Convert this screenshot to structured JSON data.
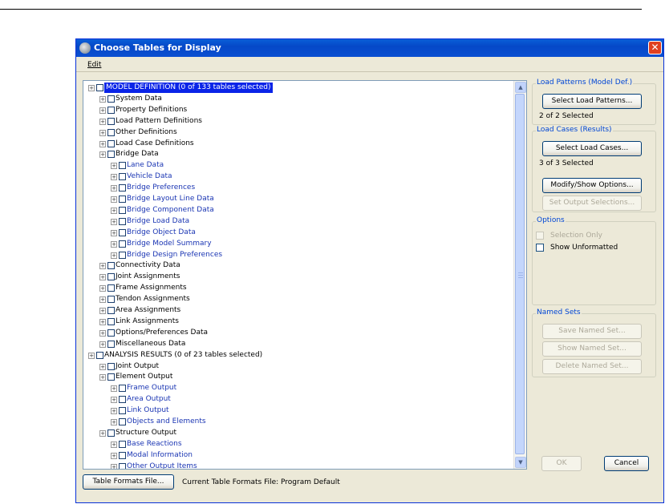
{
  "window": {
    "title": "Choose Tables for Display",
    "close_glyph": "✕",
    "icon": "app-globe-icon"
  },
  "menu": {
    "edit": "Edit"
  },
  "tree": {
    "rows": [
      {
        "label": "MODEL DEFINITION  (0 of 133 tables selected)",
        "level": 0,
        "color": "black",
        "selected": true
      },
      {
        "label": "System Data",
        "level": 1,
        "color": "black"
      },
      {
        "label": "Property Definitions",
        "level": 1,
        "color": "black"
      },
      {
        "label": "Load Pattern Definitions",
        "level": 1,
        "color": "black"
      },
      {
        "label": "Other Definitions",
        "level": 1,
        "color": "black"
      },
      {
        "label": "Load Case Definitions",
        "level": 1,
        "color": "black"
      },
      {
        "label": "Bridge Data",
        "level": 1,
        "color": "black"
      },
      {
        "label": "Lane Data",
        "level": 2,
        "color": "blue"
      },
      {
        "label": "Vehicle Data",
        "level": 2,
        "color": "blue"
      },
      {
        "label": "Bridge Preferences",
        "level": 2,
        "color": "blue"
      },
      {
        "label": "Bridge Layout Line Data",
        "level": 2,
        "color": "blue"
      },
      {
        "label": "Bridge Component Data",
        "level": 2,
        "color": "blue"
      },
      {
        "label": "Bridge Load Data",
        "level": 2,
        "color": "blue"
      },
      {
        "label": "Bridge Object Data",
        "level": 2,
        "color": "blue"
      },
      {
        "label": "Bridge Model Summary",
        "level": 2,
        "color": "blue"
      },
      {
        "label": "Bridge Design Preferences",
        "level": 2,
        "color": "blue"
      },
      {
        "label": "Connectivity Data",
        "level": 1,
        "color": "black"
      },
      {
        "label": "Joint Assignments",
        "level": 1,
        "color": "black"
      },
      {
        "label": "Frame Assignments",
        "level": 1,
        "color": "black"
      },
      {
        "label": "Tendon Assignments",
        "level": 1,
        "color": "black"
      },
      {
        "label": "Area Assignments",
        "level": 1,
        "color": "black"
      },
      {
        "label": "Link Assignments",
        "level": 1,
        "color": "black"
      },
      {
        "label": "Options/Preferences Data",
        "level": 1,
        "color": "black"
      },
      {
        "label": "Miscellaneous Data",
        "level": 1,
        "color": "black"
      },
      {
        "label": "ANALYSIS RESULTS  (0 of 23 tables selected)",
        "level": 0,
        "color": "black"
      },
      {
        "label": "Joint Output",
        "level": 1,
        "color": "black"
      },
      {
        "label": "Element Output",
        "level": 1,
        "color": "black"
      },
      {
        "label": "Frame Output",
        "level": 2,
        "color": "blue"
      },
      {
        "label": "Area Output",
        "level": 2,
        "color": "blue"
      },
      {
        "label": "Link Output",
        "level": 2,
        "color": "blue"
      },
      {
        "label": "Objects and Elements",
        "level": 2,
        "color": "blue"
      },
      {
        "label": "Structure Output",
        "level": 1,
        "color": "black"
      },
      {
        "label": "Base Reactions",
        "level": 2,
        "color": "blue"
      },
      {
        "label": "Modal Information",
        "level": 2,
        "color": "blue"
      },
      {
        "label": "Other Output Items",
        "level": 2,
        "color": "blue"
      }
    ],
    "expander_glyph": "+",
    "scroll_up_glyph": "▲",
    "scroll_down_glyph": "▼"
  },
  "load_patterns": {
    "title": "Load Patterns (Model Def.)",
    "button": "Select Load Patterns...",
    "status": "2 of 2 Selected"
  },
  "load_cases": {
    "title": "Load Cases (Results)",
    "button": "Select Load Cases...",
    "status": "3 of 3 Selected",
    "modify_button": "Modify/Show Options...",
    "output_button": "Set Output Selections..."
  },
  "options": {
    "title": "Options",
    "selection_only": "Selection Only",
    "show_unformatted": "Show Unformatted"
  },
  "named_sets": {
    "title": "Named Sets",
    "save": "Save Named Set...",
    "show": "Show Named Set...",
    "delete": "Delete Named Set..."
  },
  "footer": {
    "formats_button": "Table Formats File...",
    "current_label": "Current Table Formats File:  Program Default",
    "ok": "OK",
    "cancel": "Cancel"
  },
  "colors": {
    "title_bar": "#0548c8",
    "selection": "#0a24e8",
    "link_blue": "#1a35b3",
    "group_title": "#0046d5"
  }
}
